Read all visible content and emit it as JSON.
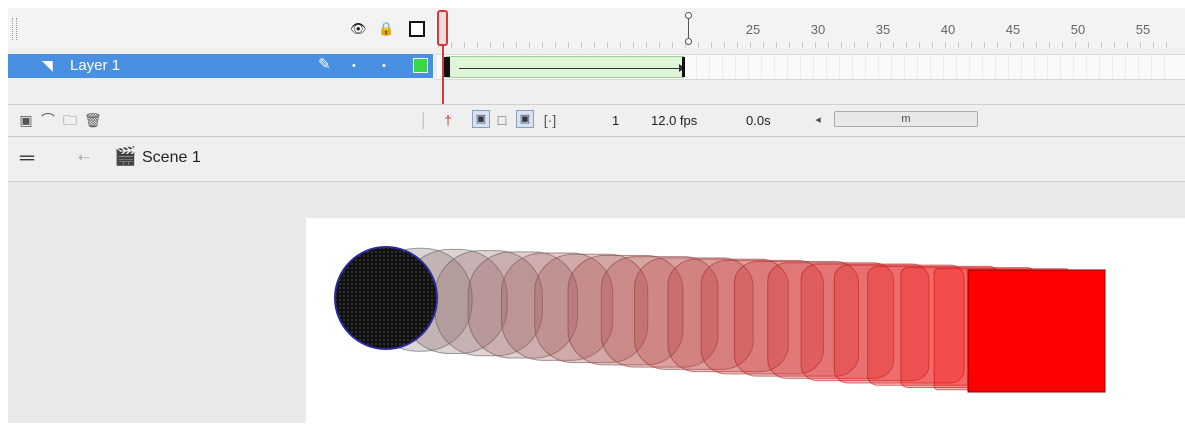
{
  "timeline": {
    "layer": {
      "name": "Layer 1",
      "color": "#3ad64a"
    },
    "ruler_numbers": [
      "25",
      "30",
      "35",
      "40",
      "45",
      "50",
      "55"
    ],
    "fps": "12.0 fps",
    "time": "0.0s",
    "current_frame": "1",
    "scroll_thumb": "m"
  },
  "edit_bar": {
    "scene": "Scene 1"
  },
  "stage": {
    "tween_frames": 19,
    "start_shape": {
      "type": "circle",
      "color": "#111111"
    },
    "end_shape": {
      "type": "square",
      "color": "#ff0000"
    }
  }
}
